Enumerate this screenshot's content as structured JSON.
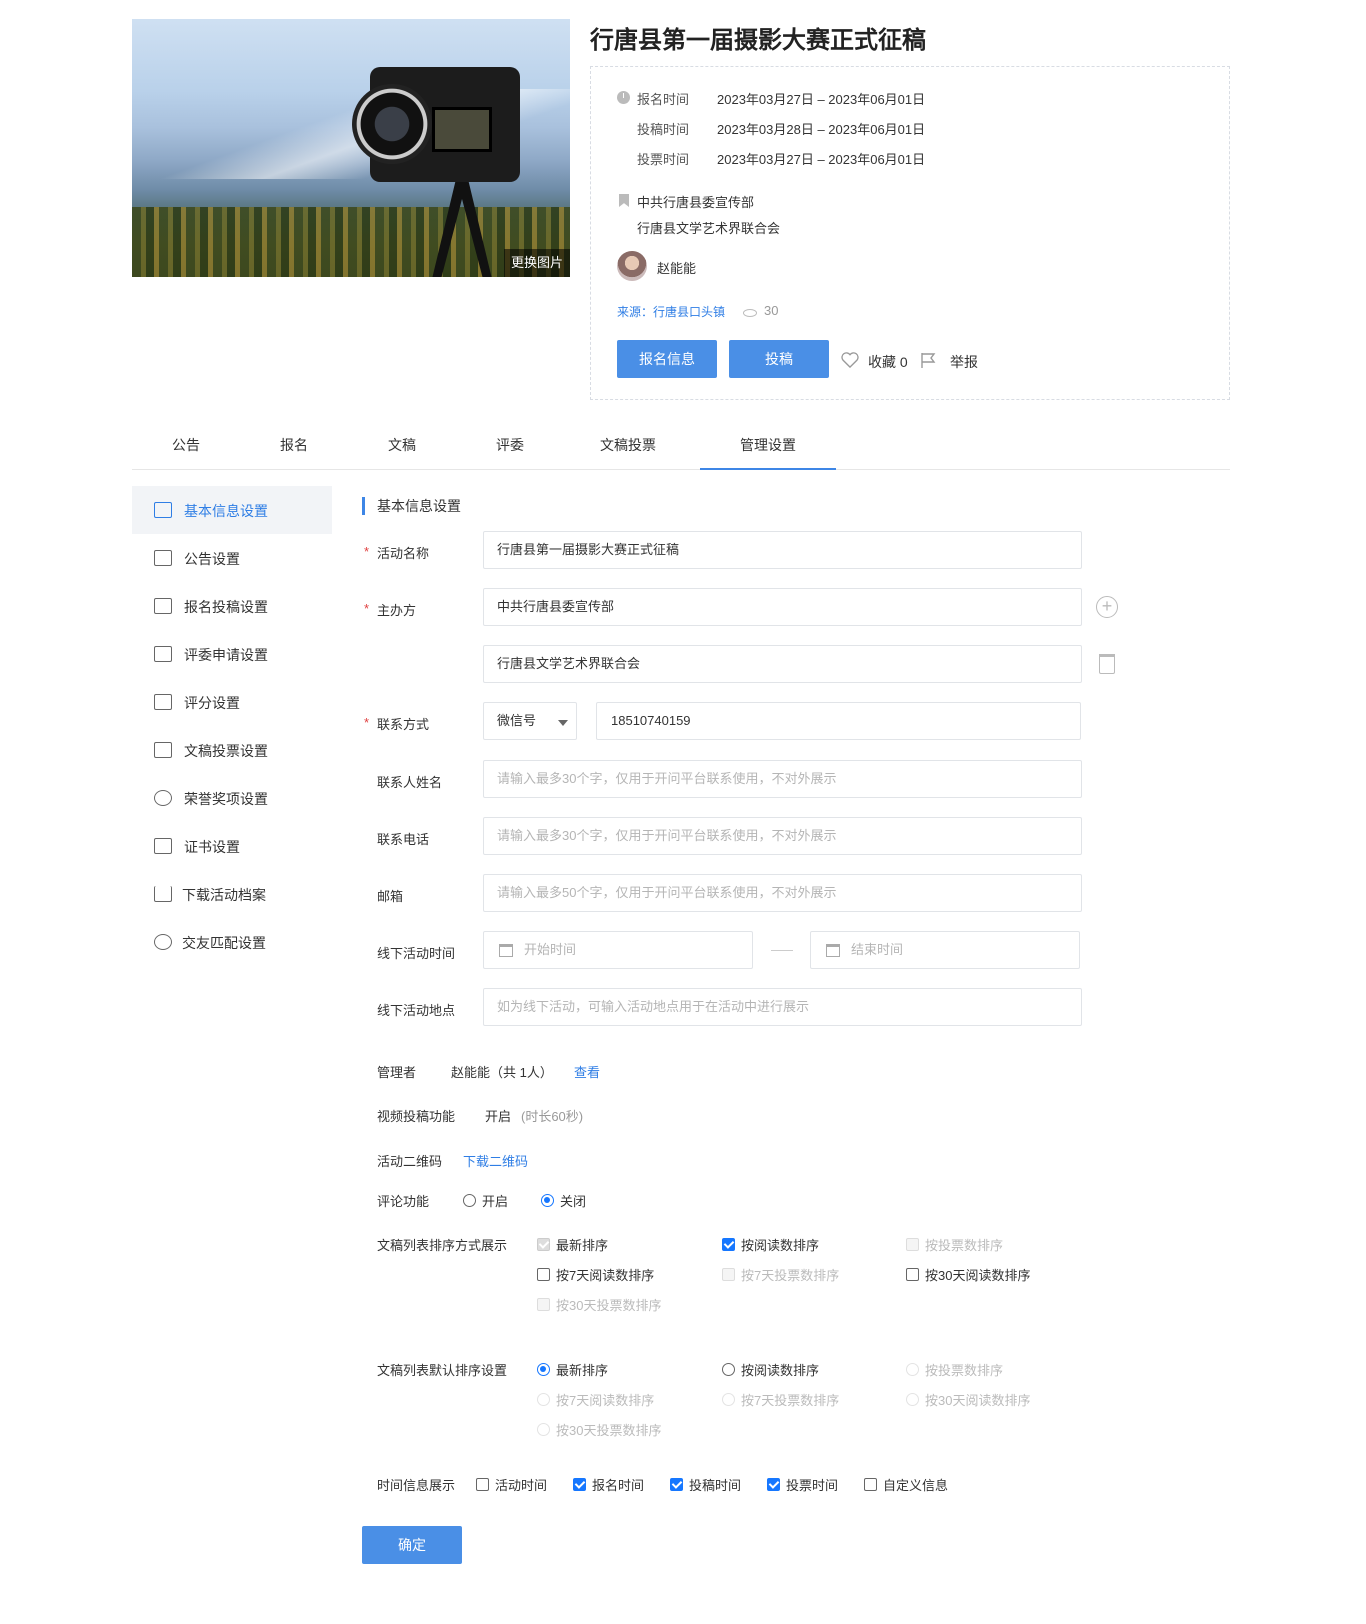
{
  "cover": {
    "change_label": "更换图片"
  },
  "title": "行唐县第一届摄影大赛正式征稿",
  "info": {
    "signup_label": "报名时间",
    "signup_value": "2023年03月27日 – 2023年06月01日",
    "submit_label": "投稿时间",
    "submit_value": "2023年03月28日 – 2023年06月01日",
    "vote_label": "投票时间",
    "vote_value": "2023年03月27日 – 2023年06月01日",
    "organizers": [
      "中共行唐县委宣传部",
      "行唐县文学艺术界联合会"
    ],
    "author": "赵能能",
    "source_label": "来源：",
    "source_value": "行唐县口头镇",
    "views": "30"
  },
  "actions": {
    "signup_info": "报名信息",
    "submit": "投稿",
    "favorite": "收藏 0",
    "report": "举报"
  },
  "tabs": [
    "公告",
    "报名",
    "文稿",
    "评委",
    "文稿投票",
    "管理设置"
  ],
  "sidebar": [
    "基本信息设置",
    "公告设置",
    "报名投稿设置",
    "评委申请设置",
    "评分设置",
    "文稿投票设置",
    "荣誉奖项设置",
    "证书设置",
    "下载活动档案",
    "交友匹配设置"
  ],
  "form": {
    "section_title": "基本信息设置",
    "required_mark": "*",
    "activity_name_label": "活动名称",
    "activity_name_value": "行唐县第一届摄影大赛正式征稿",
    "host_label": "主办方",
    "host_value_1": "中共行唐县委宣传部",
    "host_value_2": "行唐县文学艺术界联合会",
    "contact_label": "联系方式",
    "contact_type": "微信号",
    "contact_value": "18510740159",
    "contact_name_label": "联系人姓名",
    "contact_name_ph": "请输入最多30个字，仅用于开问平台联系使用，不对外展示",
    "phone_label": "联系电话",
    "phone_ph": "请输入最多30个字，仅用于开问平台联系使用，不对外展示",
    "email_label": "邮箱",
    "email_ph": "请输入最多50个字，仅用于开问平台联系使用，不对外展示",
    "offline_time_label": "线下活动时间",
    "start_ph": "开始时间",
    "end_ph": "结束时间",
    "offline_place_label": "线下活动地点",
    "offline_place_ph": "如为线下活动，可输入活动地点用于在活动中进行展示",
    "admin_label": "管理者",
    "admin_value": "赵能能（共 1人）",
    "admin_view": "查看",
    "video_label": "视频投稿功能",
    "video_value": "开启",
    "video_note": "(时长60秒)",
    "qr_label": "活动二维码",
    "qr_download": "下载二维码",
    "comment_label": "评论功能",
    "comment_on": "开启",
    "comment_off": "关闭",
    "sort_display_label": "文稿列表排序方式展示",
    "sort_default_label": "文稿列表默认排序设置",
    "sort_options": [
      "最新排序",
      "按阅读数排序",
      "按投票数排序",
      "按7天阅读数排序",
      "按7天投票数排序",
      "按30天阅读数排序",
      "按30天投票数排序"
    ],
    "time_display_label": "时间信息展示",
    "time_options": [
      "活动时间",
      "报名时间",
      "投稿时间",
      "投票时间",
      "自定义信息"
    ],
    "confirm": "确定"
  },
  "colors": {
    "accent": "#3d86e6",
    "button": "#4a8fe6",
    "link": "#2f7ee5",
    "required": "#e04040"
  }
}
